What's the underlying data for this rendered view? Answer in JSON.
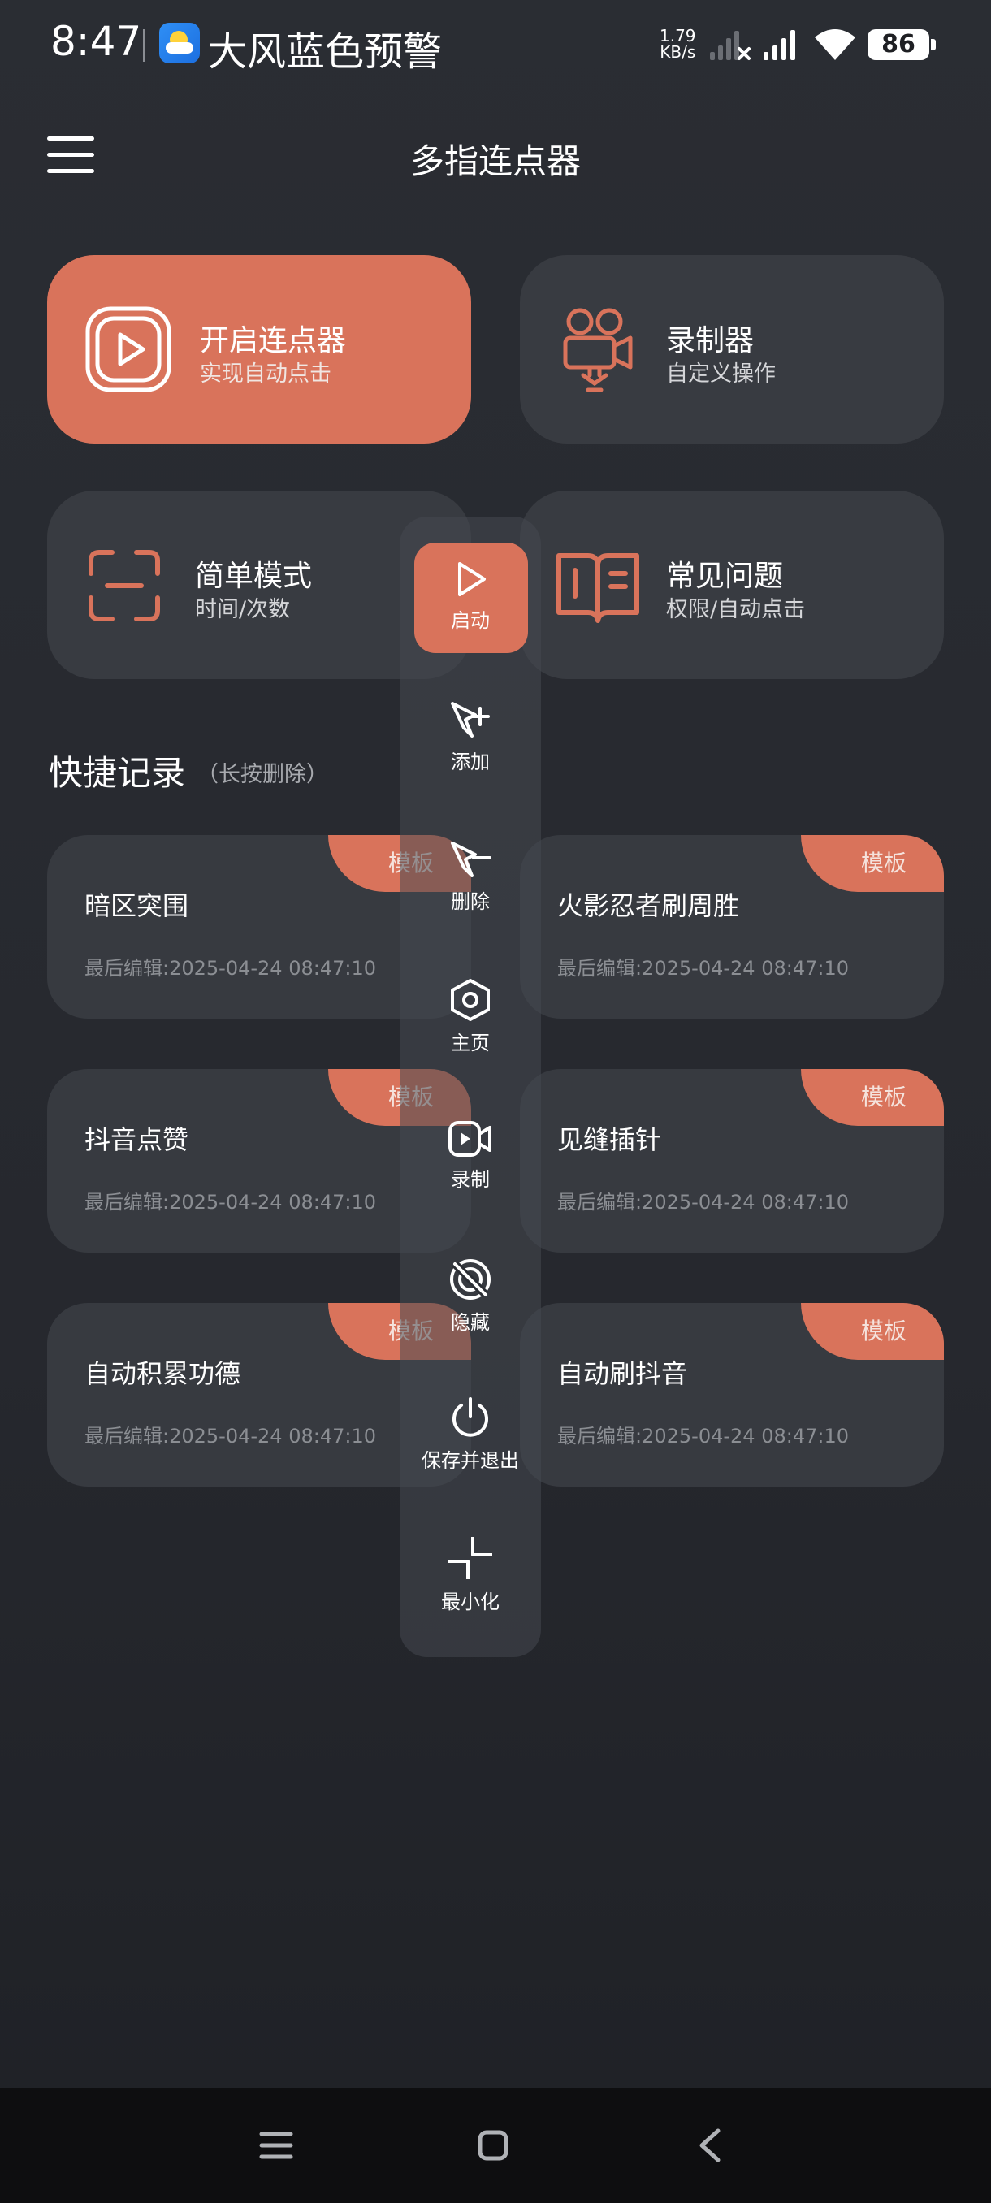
{
  "status_bar": {
    "time": "8:47",
    "alert": "大风蓝色预警",
    "net_speed_value": "1.79",
    "net_speed_unit": "KB/s",
    "battery": "86"
  },
  "header": {
    "title": "多指连点器"
  },
  "features": [
    {
      "title": "开启连点器",
      "subtitle": "实现自动点击",
      "icon": "play-icon",
      "active": true
    },
    {
      "title": "录制器",
      "subtitle": "自定义操作",
      "icon": "camera-icon",
      "active": false
    },
    {
      "title": "简单模式",
      "subtitle": "时间/次数",
      "icon": "scan-icon",
      "active": false
    },
    {
      "title": "常见问题",
      "subtitle": "权限/自动点击",
      "icon": "book-icon",
      "active": false
    }
  ],
  "quick_records": {
    "title": "快捷记录",
    "hint": "（长按删除）",
    "badge": "模板",
    "items": [
      {
        "title": "暗区突围",
        "date": "最后编辑:2025-04-24 08:47:10"
      },
      {
        "title": "火影忍者刷周胜",
        "date": "最后编辑:2025-04-24 08:47:10"
      },
      {
        "title": "抖音点赞",
        "date": "最后编辑:2025-04-24 08:47:10"
      },
      {
        "title": "见缝插针",
        "date": "最后编辑:2025-04-24 08:47:10"
      },
      {
        "title": "自动积累功德",
        "date": "最后编辑:2025-04-24 08:47:10"
      },
      {
        "title": "自动刷抖音",
        "date": "最后编辑:2025-04-24 08:47:10"
      }
    ]
  },
  "toolbar": {
    "start": "启动",
    "add": "添加",
    "delete": "删除",
    "home": "主页",
    "record": "录制",
    "hide": "隐藏",
    "save_exit": "保存并退出",
    "minimize": "最小化"
  },
  "colors": {
    "accent": "#d9735b",
    "card": "#383b41",
    "background": "#2a2d33"
  }
}
